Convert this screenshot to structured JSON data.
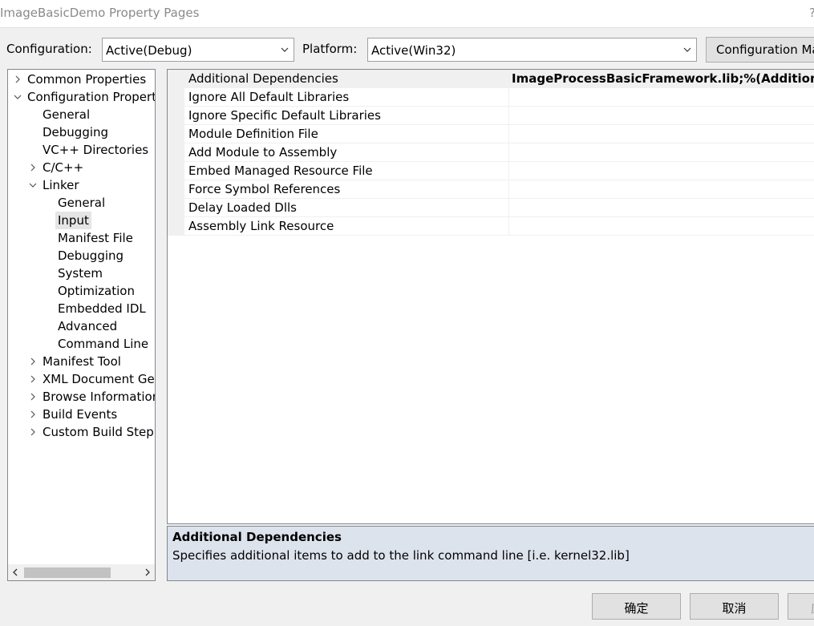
{
  "window": {
    "title": "ImageBasicDemo Property Pages",
    "help_glyph": "?"
  },
  "header": {
    "configuration_label": "Configuration:",
    "configuration_value": "Active(Debug)",
    "platform_label": "Platform:",
    "platform_value": "Active(Win32)",
    "config_manager_label": "Configuration Ma"
  },
  "tree": {
    "items": [
      {
        "label": "Common Properties",
        "chevron": "right"
      },
      {
        "label": "Configuration Propert",
        "chevron": "down"
      },
      {
        "label": "General"
      },
      {
        "label": "Debugging"
      },
      {
        "label": "VC++ Directories"
      },
      {
        "label": "C/C++",
        "chevron": "right"
      },
      {
        "label": "Linker",
        "chevron": "down"
      },
      {
        "label": "General"
      },
      {
        "label": "Input",
        "selected": true
      },
      {
        "label": "Manifest File"
      },
      {
        "label": "Debugging"
      },
      {
        "label": "System"
      },
      {
        "label": "Optimization"
      },
      {
        "label": "Embedded IDL"
      },
      {
        "label": "Advanced"
      },
      {
        "label": "Command Line"
      },
      {
        "label": "Manifest Tool",
        "chevron": "right"
      },
      {
        "label": "XML Document Ger",
        "chevron": "right"
      },
      {
        "label": "Browse Informatior",
        "chevron": "right"
      },
      {
        "label": "Build Events",
        "chevron": "right"
      },
      {
        "label": "Custom Build Step",
        "chevron": "right"
      }
    ]
  },
  "properties": [
    {
      "name": "Additional Dependencies",
      "value": "ImageProcessBasicFramework.lib;%(AdditionalDep",
      "selected": true
    },
    {
      "name": "Ignore All Default Libraries",
      "value": ""
    },
    {
      "name": "Ignore Specific Default Libraries",
      "value": ""
    },
    {
      "name": "Module Definition File",
      "value": ""
    },
    {
      "name": "Add Module to Assembly",
      "value": ""
    },
    {
      "name": "Embed Managed Resource File",
      "value": ""
    },
    {
      "name": "Force Symbol References",
      "value": ""
    },
    {
      "name": "Delay Loaded Dlls",
      "value": ""
    },
    {
      "name": "Assembly Link Resource",
      "value": ""
    }
  ],
  "description": {
    "title": "Additional Dependencies",
    "text": "Specifies additional items to add to the link command line [i.e. kernel32.lib]"
  },
  "footer": {
    "ok_label": "确定",
    "cancel_label": "取消",
    "apply_label": "应"
  }
}
